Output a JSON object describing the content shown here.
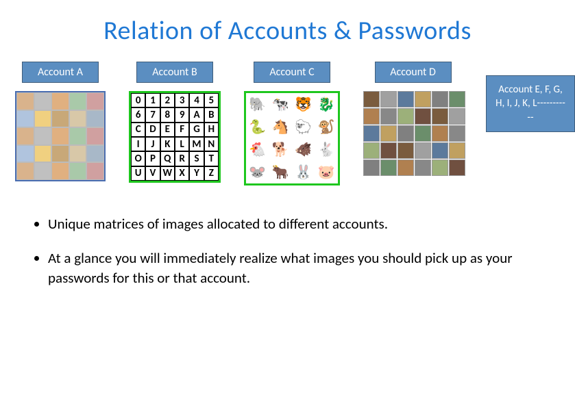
{
  "title": "Relation of Accounts & Passwords",
  "accounts": {
    "a": {
      "label": "Account A"
    },
    "b": {
      "label": "Account B",
      "chars": [
        "0",
        "1",
        "2",
        "3",
        "4",
        "5",
        "6",
        "7",
        "8",
        "9",
        "A",
        "B",
        "C",
        "D",
        "E",
        "F",
        "G",
        "H",
        "I",
        "J",
        "K",
        "L",
        "M",
        "N",
        "O",
        "P",
        "Q",
        "R",
        "S",
        "T",
        "U",
        "V",
        "W",
        "X",
        "Y",
        "Z"
      ]
    },
    "c": {
      "label": "Account C",
      "icons": [
        "🐘",
        "🐄",
        "🐯",
        "🐉",
        "🐍",
        "🐴",
        "🐑",
        "🐒",
        "🐔",
        "🐕",
        "🐗",
        "🐇",
        "🐭",
        "🐂",
        "🐰",
        "🐷"
      ]
    },
    "d": {
      "label": "Account D"
    },
    "e": {
      "label": "Account E, F, G, H, I, J, K, L-----------"
    }
  },
  "bullets": [
    "Unique matrices of images allocated to different accounts.",
    "At a glance you will immediately realize what images you should pick up as your passwords for this or that account."
  ]
}
